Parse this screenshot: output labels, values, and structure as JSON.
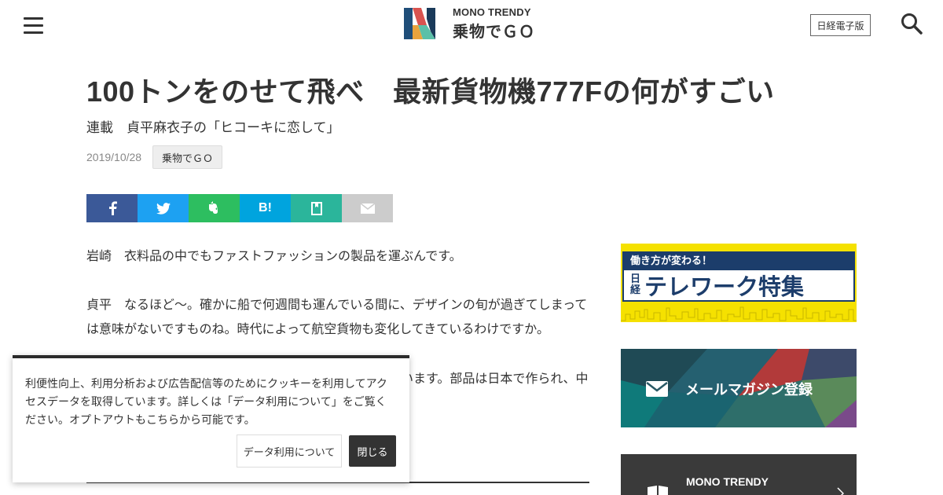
{
  "header": {
    "menu_icon": "hamburger-menu-icon",
    "logo_top": "MONO TRENDY",
    "logo_bottom": "乗物でＧＯ",
    "nikkei_label": "日経電子版",
    "search_icon": "search-icon"
  },
  "article": {
    "title": "100トンをのせて飛べ　最新貨物機777Fの何がすごい",
    "subtitle": "連載　貞平麻衣子の「ヒコーキに恋して」",
    "date": "2019/10/28",
    "category": "乗物でＧＯ",
    "share": {
      "facebook_icon": "facebook-icon",
      "twitter_icon": "twitter-icon",
      "evernote_icon": "evernote-icon",
      "hatena_label": "B!",
      "pocket_icon": "pocket-icon",
      "mail_icon": "mail-icon"
    },
    "paragraphs": [
      "岩崎　衣料品の中でもファストファッションの製品を運ぶんです。",
      "貞平　なるほど～。確かに船で何週間も運んでいる間に、デザインの旬が過ぎてしまっては意味がないですものね。時代によって航空貨物も変化してきているわけですか。",
      "います。部品は日本で作られ、中"
    ]
  },
  "sidebar": {
    "telework_top": "働き方が変わる！",
    "telework_nikkei": "日経",
    "telework_title": "テレワーク特集",
    "mail_label": "メールマガジン登録",
    "mono_label": "MONO TRENDY"
  },
  "cookie": {
    "text": "利便性向上、利用分析および広告配信等のためにクッキーを利用してアクセスデータを取得しています。詳しくは「データ利用について」をご覧ください。オプトアウトもこちらから可能です。",
    "data_button": "データ利用について",
    "close_button": "閉じる"
  },
  "colors": {
    "facebook": "#3b5998",
    "twitter": "#1da1f2",
    "evernote": "#2dbe60",
    "hatena": "#00a4de",
    "pocket": "#2bb59b",
    "mail": "#cccccc",
    "telework_yellow": "#f5e100",
    "telework_navy": "#1c3d6b"
  }
}
